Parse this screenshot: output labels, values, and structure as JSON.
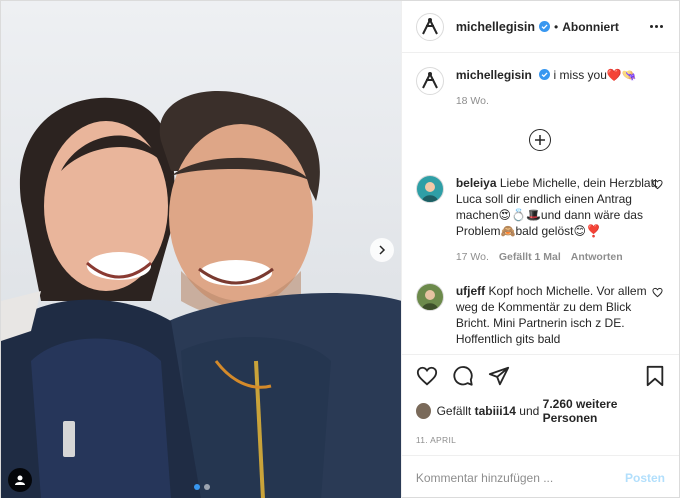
{
  "header": {
    "username": "michellegisin",
    "separator": "•",
    "follow_state": "Abonniert"
  },
  "caption": {
    "username": "michellegisin",
    "text": "i miss you❤️👒",
    "time": "18 Wo."
  },
  "comments": [
    {
      "username": "beleiya",
      "text": "Liebe Michelle, dein Herzblatt Luca soll dir endlich einen Antrag machen😍💍🎩und dann wäre das Problem🙈bald gelöst😊❣️",
      "time": "17 Wo.",
      "likes": "Gefällt 1 Mal",
      "reply": "Antworten",
      "avatar_color": "#2f9fa6"
    },
    {
      "username": "ufjeff",
      "text": "Kopf hoch Michelle. Vor allem weg de Kommentär zu dem Blick Bricht. Mini Partnerin isch z DE. Hoffentlich gits bald",
      "avatar_color": "#6c8a4b"
    }
  ],
  "likes": {
    "prefix": "Gefällt",
    "user": "tabiii14",
    "middle": "und",
    "count": "7.260 weitere Personen"
  },
  "date": "11. April",
  "comment_input": {
    "placeholder": "Kommentar hinzufügen ..."
  },
  "post_label": "Posten",
  "icons": {
    "verified": "verified-badge-icon",
    "more": "more-options-icon",
    "load_more": "plus-circle-icon",
    "like": "heart-icon",
    "comment": "comment-icon",
    "share": "paper-plane-icon",
    "save": "bookmark-icon",
    "next": "chevron-right-icon",
    "tag": "user-tag-icon"
  },
  "colors": {
    "verified": "#3897f0",
    "post_button": "#b2dffc",
    "muted": "#8e8e8e"
  }
}
